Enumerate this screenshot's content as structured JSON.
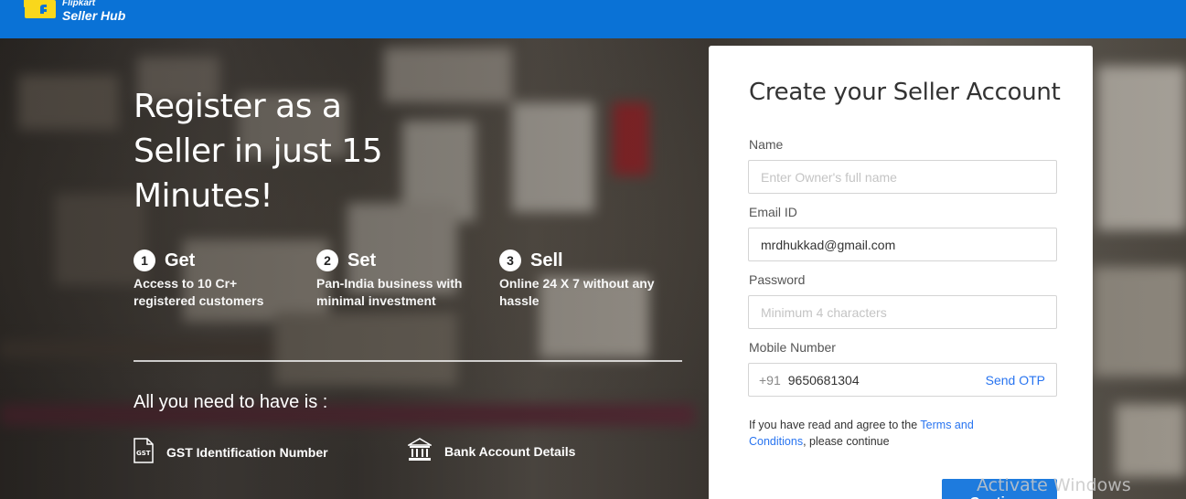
{
  "header": {
    "brand": "Flipkart",
    "product": "Seller Hub",
    "logo_icon": "flipkart-bag-icon",
    "bar_color": "#0a72d6"
  },
  "hero": {
    "title": "Register as a Seller in just 15 Minutes!",
    "steps": [
      {
        "num": "1",
        "title": "Get",
        "desc": "Access to 10 Cr+ registered customers"
      },
      {
        "num": "2",
        "title": "Set",
        "desc": "Pan-India business with minimal investment"
      },
      {
        "num": "3",
        "title": "Sell",
        "desc": "Online 24 X 7 without any hassle"
      }
    ],
    "needs_title": "All you need to have is :",
    "needs": [
      {
        "label": "GST Identification Number",
        "icon": "gst-document-icon",
        "icon_text": "GST"
      },
      {
        "label": "Bank Account Details",
        "icon": "bank-icon"
      }
    ]
  },
  "form": {
    "title": "Create your Seller Account",
    "name_label": "Name",
    "name_placeholder": "Enter Owner's full name",
    "name_value": "",
    "email_label": "Email ID",
    "email_value": "mrdhukkad@gmail.com",
    "password_label": "Password",
    "password_placeholder": "Minimum 4 characters",
    "mobile_label": "Mobile Number",
    "country_code": "+91",
    "mobile_value": "9650681304",
    "send_otp": "Send OTP",
    "terms_prefix": "If you have read and agree to the ",
    "terms_link": "Terms and Conditions",
    "terms_suffix": ", please continue",
    "continue_label": "Continue",
    "accent_color": "#2874f0"
  },
  "watermark": "Activate Windows"
}
